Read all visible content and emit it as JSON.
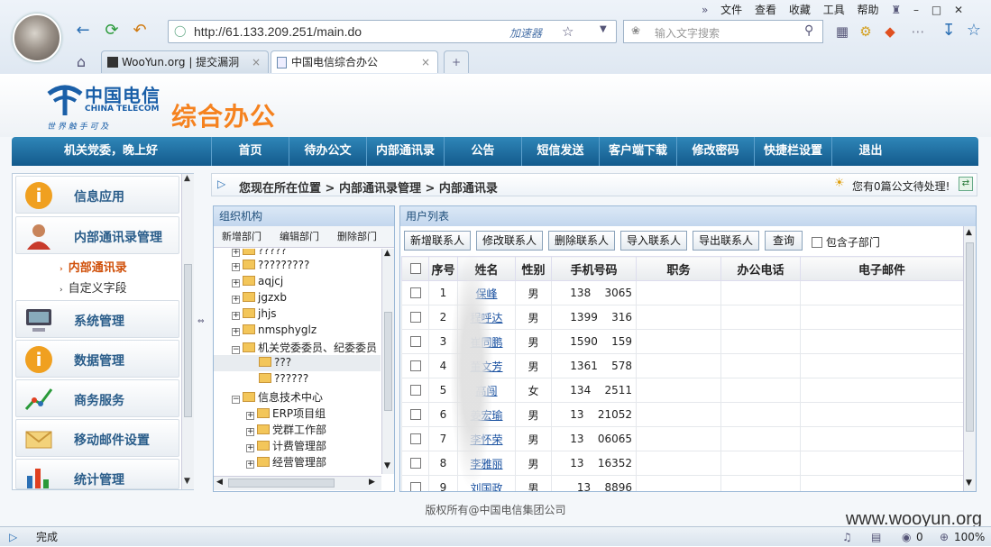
{
  "browser": {
    "url": "http://61.133.209.251/main.do",
    "accelerator": "加速器",
    "search_placeholder": "输入文字搜索",
    "menu": [
      "文件",
      "查看",
      "收藏",
      "工具",
      "帮助"
    ],
    "tabs": [
      {
        "label": "WooYun.org | 提交漏洞"
      },
      {
        "label": "中国电信综合办公"
      }
    ],
    "status": "完成",
    "zoom": "100%",
    "counter": "0"
  },
  "header": {
    "brand_cn": "中国电信",
    "brand_en": "CHINA TELECOM",
    "slogan": "世 界 触 手 可 及",
    "title": "综合办公"
  },
  "nav": {
    "greeting": "机关党委，晚上好",
    "items": [
      "首页",
      "待办公文",
      "内部通讯录",
      "公告",
      "短信发送",
      "客户端下载",
      "修改密码",
      "快捷栏设置",
      "退出"
    ]
  },
  "sidebar": {
    "items": [
      {
        "label": "信息应用"
      },
      {
        "label": "内部通讯录管理"
      },
      {
        "label": "系统管理"
      },
      {
        "label": "数据管理"
      },
      {
        "label": "商务服务"
      },
      {
        "label": "移动邮件设置"
      },
      {
        "label": "统计管理"
      }
    ],
    "subitems": [
      "内部通讯录",
      "自定义字段"
    ]
  },
  "breadcrumb": "您现在所在位置 > 内部通讯录管理 > 内部通讯录",
  "notice": "您有0篇公文待处理!",
  "org": {
    "title": "组织机构",
    "tools": [
      "新增部门",
      "编辑部门",
      "删除部门"
    ],
    "nodes": [
      "?????",
      "?????????",
      "aqjcj",
      "jgzxb",
      "jhjs",
      "nmsphyglz",
      "机关党委委员、纪委委员",
      "???",
      "??????",
      "信息技术中心",
      "ERP项目组",
      "党群工作部",
      "计费管理部",
      "经营管理部"
    ]
  },
  "users": {
    "title": "用户列表",
    "buttons": [
      "新增联系人",
      "修改联系人",
      "删除联系人",
      "导入联系人",
      "导出联系人",
      "查询"
    ],
    "include_sub": "包含子部门",
    "columns": [
      "序号",
      "姓名",
      "性别",
      "手机号码",
      "职务",
      "办公电话",
      "电子邮件"
    ],
    "rows": [
      {
        "no": "1",
        "name": "保峰",
        "sex": "男",
        "phone": "138    3065"
      },
      {
        "no": "2",
        "name": "程呼达",
        "sex": "男",
        "phone": "1399    316"
      },
      {
        "no": "3",
        "name": "崔同鹏",
        "sex": "男",
        "phone": "1590    159"
      },
      {
        "no": "4",
        "name": "董文芳",
        "sex": "男",
        "phone": "1361    578"
      },
      {
        "no": "5",
        "name": "高闯",
        "sex": "女",
        "phone": "134    2511"
      },
      {
        "no": "6",
        "name": "姜宏瑜",
        "sex": "男",
        "phone": "13    21052"
      },
      {
        "no": "7",
        "name": "李怀荣",
        "sex": "男",
        "phone": "13    06065"
      },
      {
        "no": "8",
        "name": "李雅丽",
        "sex": "男",
        "phone": "13    16352"
      },
      {
        "no": "9",
        "name": "刘国政",
        "sex": "男",
        "phone": "13    8896"
      }
    ]
  },
  "footer": "版权所有@中国电信集团公司",
  "watermark": "www.wooyun.org"
}
